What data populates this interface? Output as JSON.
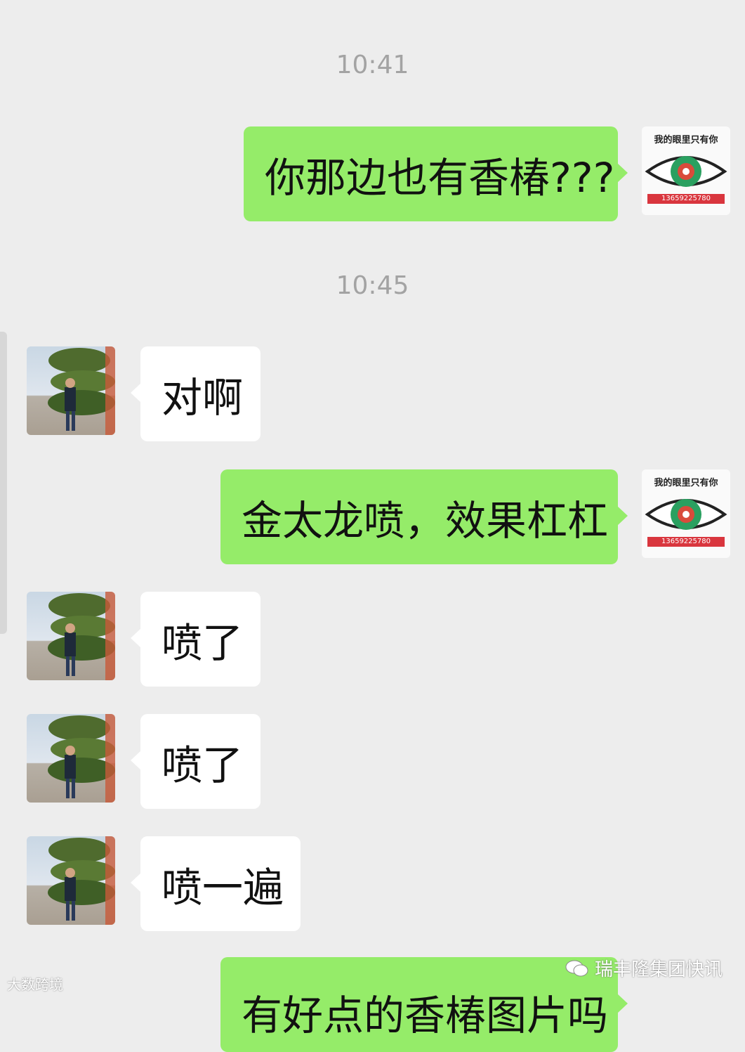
{
  "chat": {
    "timestamps": [
      "10:41",
      "10:45"
    ],
    "messages": [
      {
        "from": "me",
        "text": "你那边也有香椿???"
      },
      {
        "from": "friend",
        "text": "对啊"
      },
      {
        "from": "me",
        "text": "金太龙喷，效果杠杠"
      },
      {
        "from": "friend",
        "text": "喷了"
      },
      {
        "from": "friend",
        "text": "喷了"
      },
      {
        "from": "friend",
        "text": "喷一遍"
      },
      {
        "from": "me",
        "text": "有好点的香椿图片吗"
      }
    ]
  },
  "my_avatar": {
    "caption": "我的眼里只有你",
    "strip_text": "13659225780"
  },
  "watermarks": {
    "left": "大数跨境",
    "right": "瑞丰隆集团快讯"
  },
  "colors": {
    "background": "#ededed",
    "outgoing_bubble": "#95ec69",
    "incoming_bubble": "#ffffff",
    "timestamp_text": "#a3a3a3"
  }
}
